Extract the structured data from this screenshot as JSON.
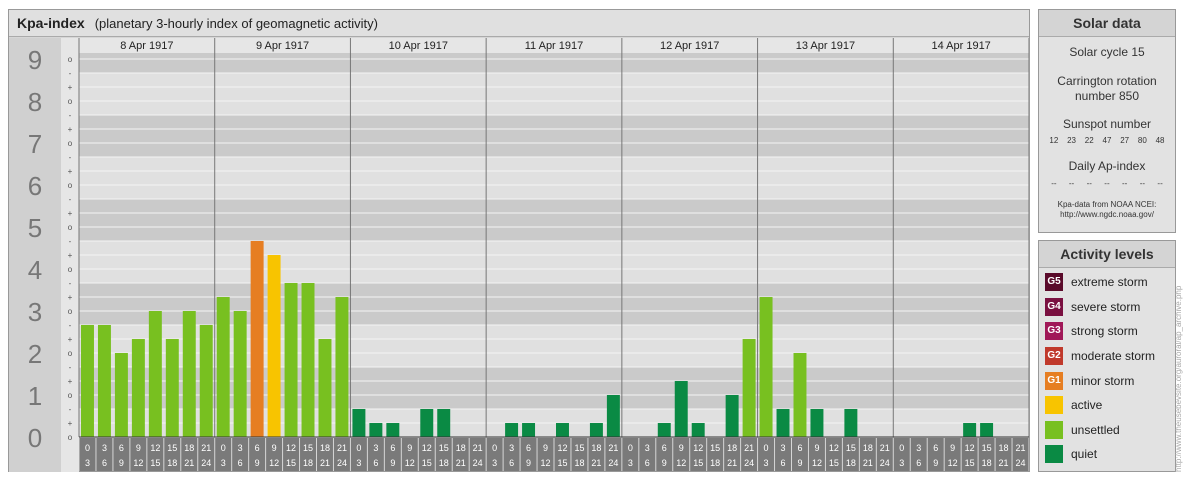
{
  "header": {
    "title": "Kpa-index",
    "subtitle": "(planetary 3-hourly index of geomagnetic activity)"
  },
  "chart_data": {
    "type": "bar",
    "title": "Kpa-index",
    "subtitle": "(planetary 3-hourly index of geomagnetic activity)",
    "y_ticks": [
      "0",
      "1",
      "2",
      "3",
      "4",
      "5",
      "6",
      "7",
      "8",
      "9"
    ],
    "y_minor_labels": [
      "o",
      "+",
      "-"
    ],
    "ylim": [
      0,
      9.33
    ],
    "days": [
      "8 Apr 1917",
      "9 Apr 1917",
      "10 Apr 1917",
      "11 Apr 1917",
      "12 Apr 1917",
      "13 Apr 1917",
      "14 Apr 1917"
    ],
    "slot_top": [
      "0",
      "3",
      "6",
      "9",
      "12",
      "15",
      "18",
      "21"
    ],
    "slot_bottom": [
      "3",
      "6",
      "9",
      "12",
      "15",
      "18",
      "21",
      "24"
    ],
    "values": [
      [
        2.667,
        2.667,
        2.0,
        2.333,
        3.0,
        2.333,
        3.0,
        2.667
      ],
      [
        3.333,
        3.0,
        4.667,
        4.333,
        3.667,
        3.667,
        2.333,
        3.333
      ],
      [
        0.667,
        0.333,
        0.333,
        0.0,
        0.667,
        0.667,
        0.0,
        0.0
      ],
      [
        0.0,
        0.333,
        0.333,
        0.0,
        0.333,
        0.0,
        0.333,
        1.0
      ],
      [
        0.0,
        0.0,
        0.333,
        1.333,
        0.333,
        0.0,
        1.0,
        2.333
      ],
      [
        3.333,
        0.667,
        2.0,
        0.667,
        0.0,
        0.667,
        0.0,
        0.0
      ],
      [
        0.0,
        0.0,
        0.0,
        0.0,
        0.333,
        0.333,
        0.0,
        0.0
      ]
    ],
    "colors": {
      "quiet": "#0a8a44",
      "unsettled": "#78c020",
      "active": "#f8c400",
      "minor": "#e67e22"
    }
  },
  "solar": {
    "title": "Solar data",
    "cycle": "Solar cycle 15",
    "carrington_l1": "Carrington rotation",
    "carrington_l2": "number 850",
    "sunspot_label": "Sunspot number",
    "sunspots": [
      "12",
      "23",
      "22",
      "47",
      "27",
      "80",
      "48"
    ],
    "ap_label": "Daily Ap-index",
    "ap_values": [
      "--",
      "--",
      "--",
      "--",
      "--",
      "--",
      "--"
    ],
    "source_l1": "Kpa-data from NOAA NCEI:",
    "source_l2": "http://www.ngdc.noaa.gov/"
  },
  "activity": {
    "title": "Activity levels",
    "levels": [
      {
        "badge": "G5",
        "label": "extreme storm",
        "color": "#5a0a2a"
      },
      {
        "badge": "G4",
        "label": "severe storm",
        "color": "#7a1040"
      },
      {
        "badge": "G3",
        "label": "strong storm",
        "color": "#a01858"
      },
      {
        "badge": "G2",
        "label": "moderate storm",
        "color": "#c0392b"
      },
      {
        "badge": "G1",
        "label": "minor storm",
        "color": "#e67e22"
      },
      {
        "badge": "",
        "label": "active",
        "color": "#f8c400"
      },
      {
        "badge": "",
        "label": "unsettled",
        "color": "#78c020"
      },
      {
        "badge": "",
        "label": "quiet",
        "color": "#0a8a44"
      }
    ]
  },
  "watermark": "http://www.theusebevsite.org/auroral/ap_archive.php"
}
